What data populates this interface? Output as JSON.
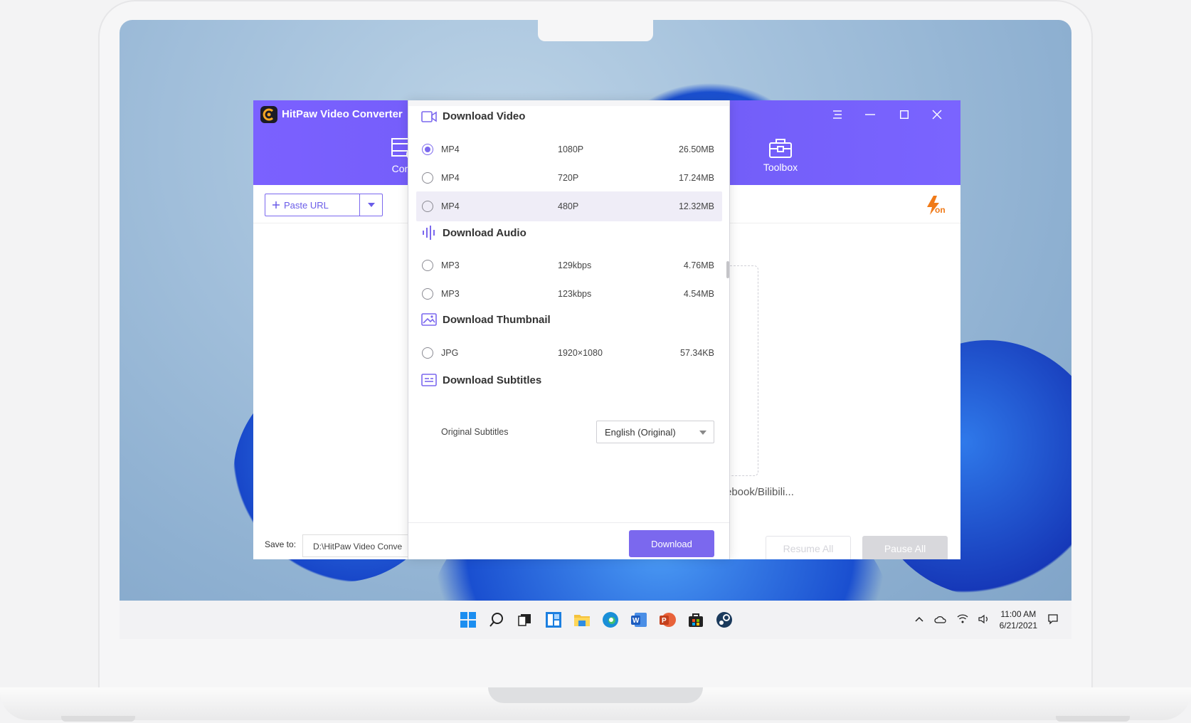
{
  "app": {
    "title": "HitPaw Video Converter",
    "tabs": [
      {
        "label": "Conv",
        "icon": "film-icon"
      },
      {
        "label": "Toolbox",
        "icon": "toolbox-icon"
      }
    ],
    "window_controls": [
      "menu-icon",
      "minimize-icon",
      "maximize-icon",
      "close-icon"
    ],
    "accent": "#7b68ee"
  },
  "toolbar": {
    "paste_url_label": "Paste URL",
    "boost_badge": "on"
  },
  "main": {
    "supported_sites_text": "ebook/Bilibili..."
  },
  "footer": {
    "save_to_label": "Save to:",
    "save_path": "D:\\HitPaw Video Conve",
    "resume_all_label": "Resume All",
    "pause_all_label": "Pause All"
  },
  "dialog": {
    "video": {
      "heading": "Download Video",
      "options": [
        {
          "format": "MP4",
          "quality": "1080P",
          "size": "26.50MB",
          "selected": true
        },
        {
          "format": "MP4",
          "quality": "720P",
          "size": "17.24MB",
          "selected": false
        },
        {
          "format": "MP4",
          "quality": "480P",
          "size": "12.32MB",
          "selected": false
        }
      ]
    },
    "audio": {
      "heading": "Download Audio",
      "options": [
        {
          "format": "MP3",
          "quality": "129kbps",
          "size": "4.76MB",
          "selected": false
        },
        {
          "format": "MP3",
          "quality": "123kbps",
          "size": "4.54MB",
          "selected": false
        }
      ]
    },
    "thumbnail": {
      "heading": "Download Thumbnail",
      "options": [
        {
          "format": "JPG",
          "quality": "1920×1080",
          "size": "57.34KB",
          "selected": false
        }
      ]
    },
    "subtitles": {
      "heading": "Download Subtitles",
      "label": "Original Subtitles",
      "selected_value": "English (Original)"
    },
    "download_label": "Download"
  },
  "taskbar": {
    "time": "11:00 AM",
    "date": "6/21/2021"
  }
}
